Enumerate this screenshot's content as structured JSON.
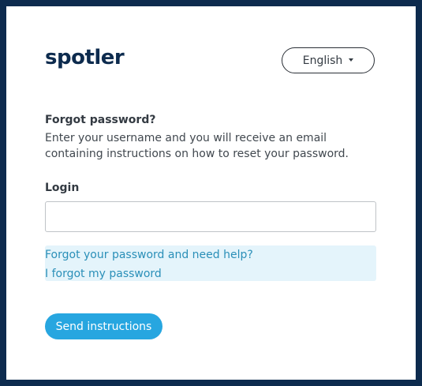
{
  "brand": {
    "logo_text": "spotler",
    "primary_color": "#0d2b4e",
    "accent_color": "#27a6e0"
  },
  "header": {
    "language_label": "English",
    "language_icon": "caret-down-icon"
  },
  "form": {
    "title": "Forgot password?",
    "description": "Enter your username and you will receive an email containing instructions on how to reset your password.",
    "login_label": "Login",
    "login_value": "",
    "login_placeholder": ""
  },
  "help": {
    "need_help_link": "Forgot your password and need help?",
    "forgot_link": "I forgot my password"
  },
  "actions": {
    "send_label": "Send instructions"
  }
}
